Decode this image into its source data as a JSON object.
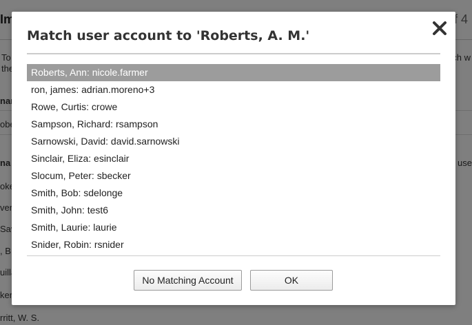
{
  "background": {
    "title_fragment": "Im",
    "page_fragment": "f 4",
    "left_fragments": [
      "To",
      "the",
      "nar",
      "obe",
      "na",
      "oke",
      "ver,",
      "Sav",
      ", B",
      "uilla",
      "ker",
      "rritt, W. S."
    ],
    "right_fragments": [
      "tch w",
      "e use"
    ]
  },
  "modal": {
    "title": "Match user account to 'Roberts, A. M.'",
    "close_label": "close",
    "accounts": [
      "Roberts, Ann: nicole.farmer",
      "ron, james: adrian.moreno+3",
      "Rowe, Curtis: crowe",
      "Sampson, Richard: rsampson",
      "Sarnowski, David: david.sarnowski",
      "Sinclair, Eliza: esinclair",
      "Slocum, Peter: sbecker",
      "Smith, Bob: sdelonge",
      "Smith, John: test6",
      "Smith, Laurie: laurie",
      "Snider, Robin: rsnider"
    ],
    "selected_index": 0,
    "no_match_label": "No Matching Account",
    "ok_label": "OK"
  }
}
